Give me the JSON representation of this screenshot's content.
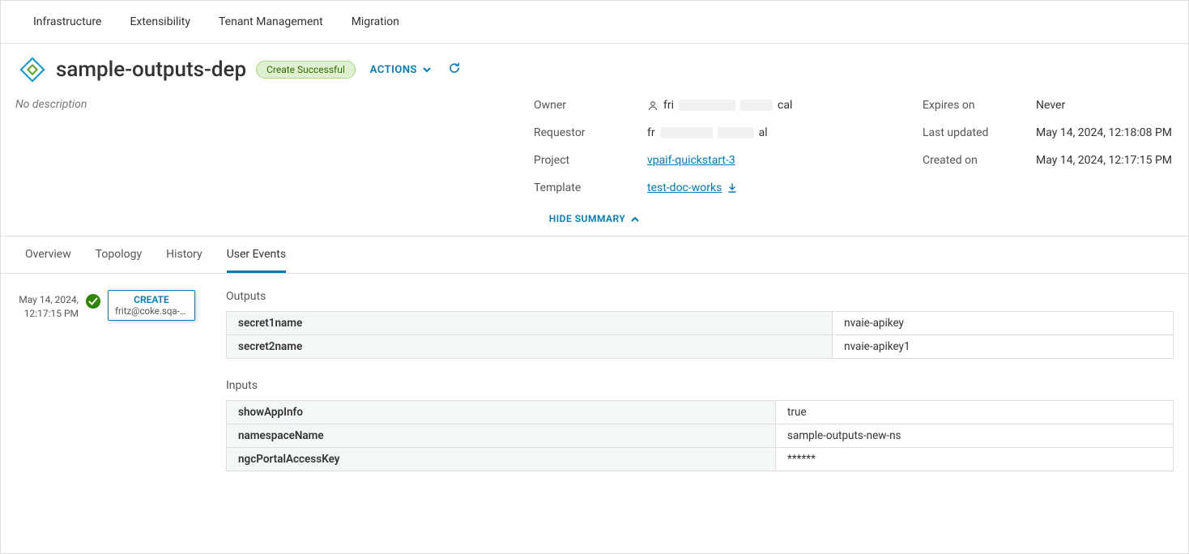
{
  "topNav": {
    "items": [
      "Infrastructure",
      "Extensibility",
      "Tenant Management",
      "Migration"
    ]
  },
  "header": {
    "title": "sample-outputs-dep",
    "status": "Create Successful",
    "actionsLabel": "ACTIONS",
    "description": "No description"
  },
  "summary": {
    "left": {
      "ownerLabel": "Owner",
      "ownerValuePrefix": "fri",
      "ownerValueSuffix": "cal",
      "requestorLabel": "Requestor",
      "requestorValuePrefix": "fr",
      "requestorValueSuffix": "al",
      "projectLabel": "Project",
      "projectValue": "vpaif-quickstart-3",
      "templateLabel": "Template",
      "templateValue": "test-doc-works"
    },
    "right": {
      "expiresLabel": "Expires on",
      "expiresValue": "Never",
      "lastUpdatedLabel": "Last updated",
      "lastUpdatedValue": "May 14, 2024, 12:18:08 PM",
      "createdOnLabel": "Created on",
      "createdOnValue": "May 14, 2024, 12:17:15 PM"
    },
    "hideSummary": "HIDE SUMMARY"
  },
  "tabs": {
    "overview": "Overview",
    "topology": "Topology",
    "history": "History",
    "userEvents": "User Events"
  },
  "event": {
    "timestamp": "May 14, 2024, 12:17:15 PM",
    "action": "CREATE",
    "user": "fritz@coke.sqa-…"
  },
  "sections": {
    "outputsTitle": "Outputs",
    "inputsTitle": "Inputs"
  },
  "outputs": [
    {
      "key": "secret1name",
      "value": "nvaie-apikey"
    },
    {
      "key": "secret2name",
      "value": "nvaie-apikey1"
    }
  ],
  "inputs": [
    {
      "key": "showAppInfo",
      "value": "true"
    },
    {
      "key": "namespaceName",
      "value": "sample-outputs-new-ns"
    },
    {
      "key": "ngcPortalAccessKey",
      "value": "******"
    }
  ]
}
